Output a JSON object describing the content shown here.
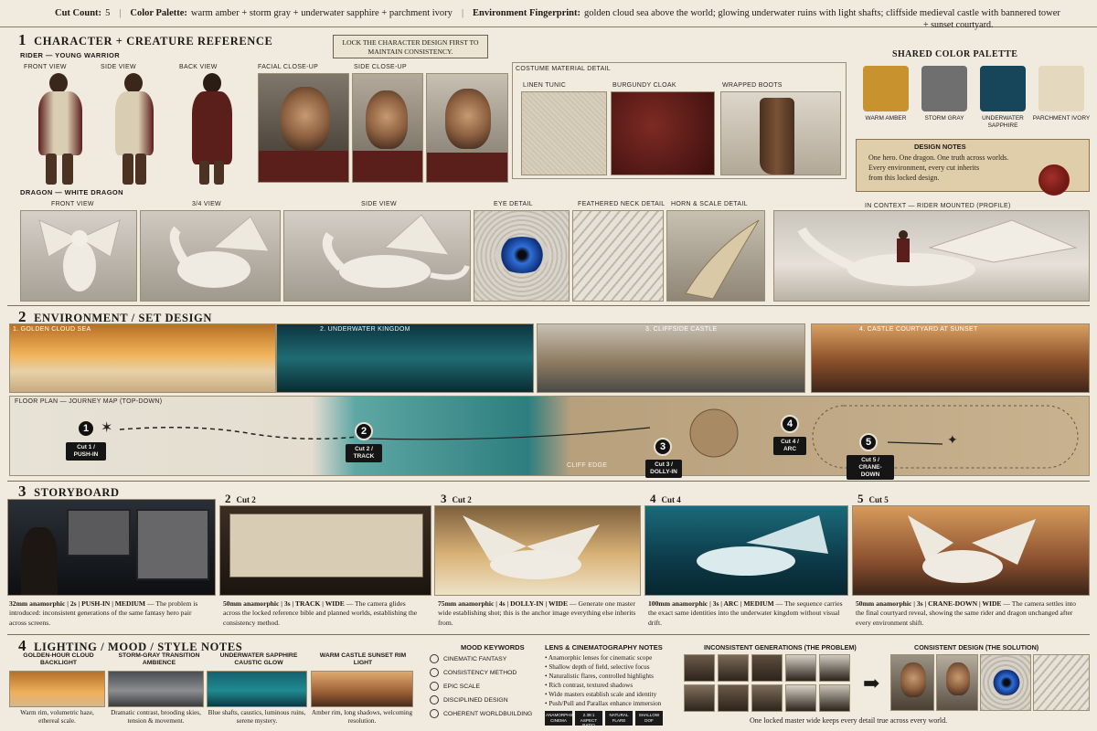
{
  "topbar": {
    "cut_label": "Cut Count:",
    "cut_value": "5",
    "palette_label": "Color Palette:",
    "palette_value": "warm amber + storm gray + underwater sapphire + parchment ivory",
    "env_label": "Environment Fingerprint:",
    "env_value": "golden cloud sea above the world; glowing underwater ruins with light shafts; cliffside medieval castle with bannered tower",
    "env_value_2": "+ sunset courtyard."
  },
  "section1": {
    "num": "1",
    "title": "CHARACTER + CREATURE REFERENCE",
    "lock_note": "LOCK THE CHARACTER DESIGN FIRST TO MAINTAIN CONSISTENCY.",
    "rider_label": "RIDER — YOUNG WARRIOR",
    "rider_views": [
      "FRONT VIEW",
      "SIDE VIEW",
      "BACK VIEW",
      "FACIAL CLOSE-UP",
      "SIDE CLOSE-UP"
    ],
    "costume_label": "COSTUME MATERIAL DETAIL",
    "materials": [
      "LINEN TUNIC",
      "BURGUNDY CLOAK",
      "WRAPPED BOOTS"
    ],
    "dragon_label": "DRAGON — WHITE DRAGON",
    "dragon_views": [
      "FRONT VIEW",
      "3/4 VIEW",
      "SIDE VIEW",
      "EYE DETAIL",
      "FEATHERED NECK DETAIL",
      "HORN & SCALE DETAIL",
      "IN CONTEXT — RIDER MOUNTED (PROFILE)"
    ]
  },
  "palette": {
    "title": "SHARED COLOR PALETTE",
    "swatches": [
      {
        "name": "WARM AMBER",
        "color": "#c8922e"
      },
      {
        "name": "STORM GRAY",
        "color": "#6f6f6f"
      },
      {
        "name": "UNDERWATER SAPPHIRE",
        "color": "#17455a"
      },
      {
        "name": "PARCHMENT IVORY",
        "color": "#e4d8bf"
      }
    ]
  },
  "design_notes": {
    "title": "DESIGN NOTES",
    "lines": [
      "One hero. One dragon. One truth across worlds.",
      "Every environment, every cut inherits",
      "from this locked design."
    ]
  },
  "section2": {
    "num": "2",
    "title": "ENVIRONMENT / SET DESIGN",
    "envs": [
      "1. GOLDEN CLOUD SEA",
      "2. UNDERWATER KINGDOM",
      "3. CLIFFSIDE CASTLE",
      "4. CASTLE COURTYARD AT SUNSET"
    ],
    "floor_label": "FLOOR PLAN — JOURNEY MAP (TOP-DOWN)",
    "cuts": [
      {
        "num": "1",
        "label": "Cut 1 / PUSH-IN"
      },
      {
        "num": "2",
        "label": "Cut 2 / TRACK"
      },
      {
        "num": "3",
        "label": "Cut 3 / DOLLY-IN"
      },
      {
        "num": "4",
        "label": "Cut 4 / ARC"
      },
      {
        "num": "5",
        "label": "Cut 5 / CRANE-DOWN"
      }
    ],
    "cliff_label": "CLIFF EDGE"
  },
  "section3": {
    "num": "3",
    "title": "STORYBOARD",
    "panels": [
      {
        "num": "",
        "cut": "",
        "spec": "32mm anamorphic | 2s | PUSH-IN | MEDIUM",
        "desc": " — The problem is introduced: inconsistent generations of the same fantasy hero pair across screens."
      },
      {
        "num": "2",
        "cut": "Cut 2",
        "spec": "50mm anamorphic | 3s | TRACK | WIDE",
        "desc": " — The camera glides across the locked reference bible and planned worlds, establishing the consistency method."
      },
      {
        "num": "3",
        "cut": "Cut 2",
        "spec": "75mm anamorphic | 4s | DOLLY-IN | WIDE",
        "desc": " — Generate one master wide establishing shot; this is the anchor image everything else inherits from."
      },
      {
        "num": "4",
        "cut": "Cut 4",
        "spec": "100mm anamorphic | 3s | ARC | MEDIUM",
        "desc": " — The sequence carries the exact same identities into the underwater kingdom without visual drift."
      },
      {
        "num": "5",
        "cut": "Cut 5",
        "spec": "50mm anamorphic | 3s | CRANE-DOWN | WIDE",
        "desc": " — The camera settles into the final courtyard reveal, showing the same rider and dragon unchanged after every environment shift."
      }
    ]
  },
  "section4": {
    "num": "4",
    "title": "LIGHTING / MOOD / STYLE NOTES",
    "lighting": [
      {
        "title": "GOLDEN-HOUR CLOUD BACKLIGHT",
        "desc": "Warm rim, volumetric haze, ethereal scale."
      },
      {
        "title": "STORM-GRAY TRANSITION AMBIENCE",
        "desc": "Dramatic contrast, brooding skies, tension & movement."
      },
      {
        "title": "UNDERWATER SAPPHIRE CAUSTIC GLOW",
        "desc": "Blue shafts, caustics, luminous ruins, serene mystery."
      },
      {
        "title": "WARM CASTLE SUNSET RIM LIGHT",
        "desc": "Amber rim, long shadows, welcoming resolution."
      }
    ],
    "mood_title": "MOOD KEYWORDS",
    "mood": [
      "CINEMATIC FANTASY",
      "CONSISTENCY METHOD",
      "EPIC SCALE",
      "DISCIPLINED DESIGN",
      "COHERENT WORLDBUILDING"
    ],
    "lens_title": "LENS & CINEMATOGRAPHY NOTES",
    "lens": [
      "• Anamorphic lenses for cinematic scope",
      "• Shallow depth of field, selective focus",
      "• Naturalistic flares, controlled highlights",
      "• Rich contrast, textured shadows",
      "• Wide masters establish scale and identity",
      "• Push/Pull and Parallax enhance immersion"
    ],
    "chips": [
      "ANAMORPHIC CINEMA",
      "2.39:1 ASPECT RATIO",
      "NATURAL FLARE",
      "SHALLOW DOF"
    ],
    "problem_title": "INCONSISTENT GENERATIONS (THE PROBLEM)",
    "solution_title": "CONSISTENT DESIGN (THE SOLUTION)",
    "footer": "One locked master wide keeps every detail true across every world."
  }
}
